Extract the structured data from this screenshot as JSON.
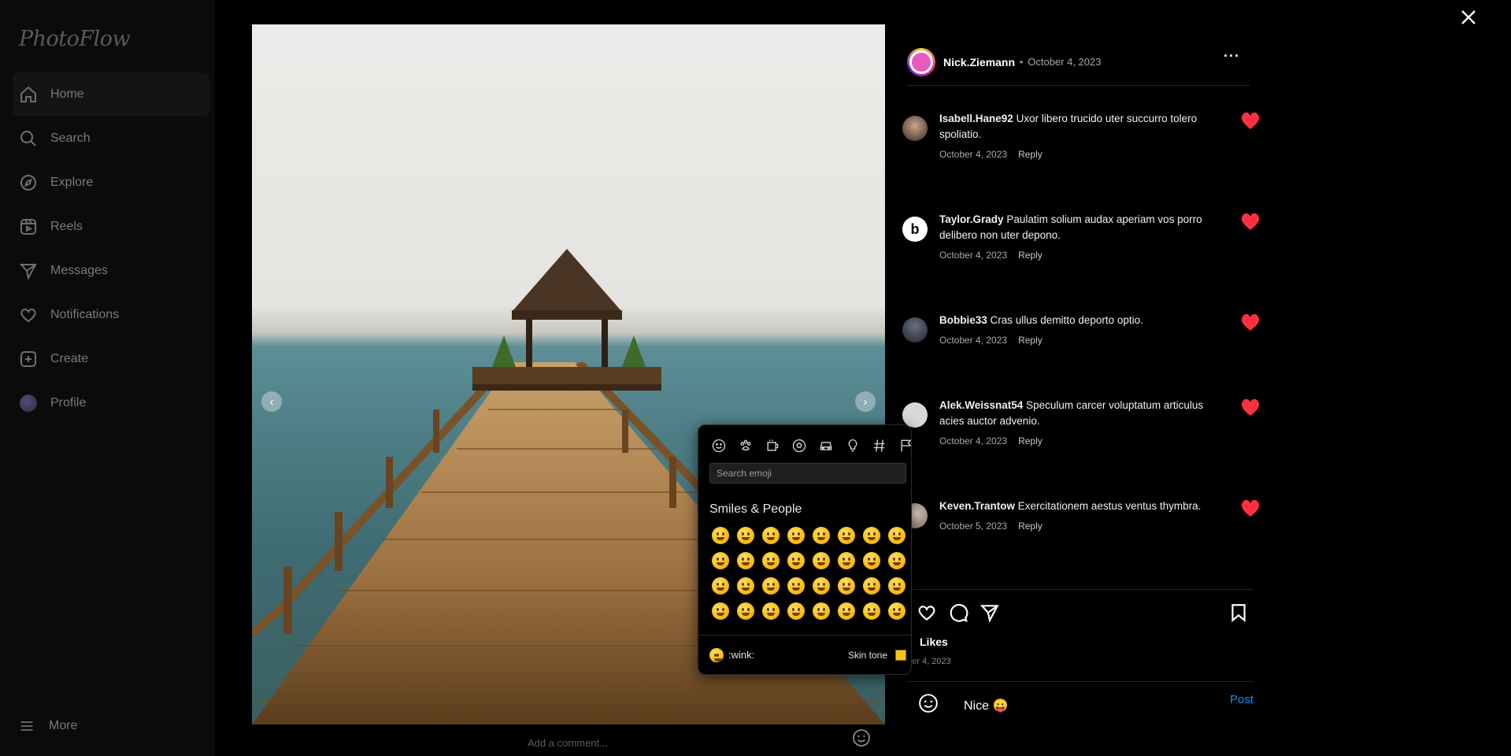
{
  "brand": "PhotoFlow",
  "nav": [
    {
      "label": "Home",
      "icon": "home-icon"
    },
    {
      "label": "Search",
      "icon": "search-icon"
    },
    {
      "label": "Explore",
      "icon": "compass-icon"
    },
    {
      "label": "Reels",
      "icon": "reels-icon"
    },
    {
      "label": "Messages",
      "icon": "send-icon"
    },
    {
      "label": "Notifications",
      "icon": "heart-icon"
    },
    {
      "label": "Create",
      "icon": "plus-square-icon"
    },
    {
      "label": "Profile",
      "icon": "avatar"
    }
  ],
  "more_label": "More",
  "post": {
    "author": "Nick.Ziemann",
    "date": "October 4, 2023",
    "likes_label": "Likes",
    "likes_date": "ber 4, 2023",
    "comment_placeholder": "Add a comment..."
  },
  "comments": [
    {
      "user": "Isabell.Hane92",
      "text": "Uxor libero trucido uter succurro tolero spoliatio.",
      "date": "October 4, 2023",
      "reply": "Reply"
    },
    {
      "user": "Taylor.Grady",
      "text": "Paulatim solium audax aperiam vos porro delibero non uter depono.",
      "date": "October 4, 2023",
      "reply": "Reply"
    },
    {
      "user": "Bobbie33",
      "text": "Cras ullus demitto deporto optio.",
      "date": "October 4, 2023",
      "reply": "Reply"
    },
    {
      "user": "Alek.Weissnat54",
      "text": "Speculum carcer voluptatum articulus acies auctor advenio.",
      "date": "October 4, 2023",
      "reply": "Reply"
    },
    {
      "user": "Keven.Trantow",
      "text": "Exercitationem aestus ventus thymbra.",
      "date": "October 5, 2023",
      "reply": "Reply"
    }
  ],
  "composer": {
    "value": "Nice 😛",
    "post_label": "Post"
  },
  "emoji_picker": {
    "search_placeholder": "Search emoji",
    "category_title": "Smiles & People",
    "categories": [
      "smiley-icon",
      "paw-icon",
      "cup-icon",
      "ball-icon",
      "car-icon",
      "bulb-icon",
      "hash-icon",
      "flag-icon"
    ],
    "emojis": [
      "😀",
      "😁",
      "😂",
      "🤣",
      "😃",
      "😄",
      "😅",
      "😆",
      "😉",
      "😊",
      "😋",
      "😎",
      "😍",
      "😘",
      "😗",
      "😙",
      "😚",
      "☺️",
      "🙂",
      "🤗",
      "🤩",
      "🤔",
      "🤨",
      "😐",
      "😑",
      "😶",
      "🙄",
      "😏",
      "😣",
      "😥",
      "😮",
      "🤐"
    ],
    "preview_code": ":wink:",
    "skin_tone_label": "Skin tone",
    "skin_tone_color": "#f5c518"
  },
  "colors": {
    "accent": "#0095f6",
    "heart": "#ff3040"
  }
}
